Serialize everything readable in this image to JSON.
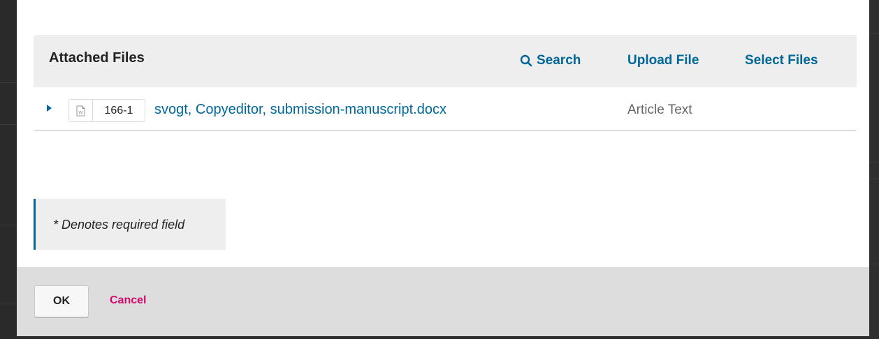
{
  "grid": {
    "title": "Attached Files",
    "actions": {
      "search": "Search",
      "upload": "Upload File",
      "select": "Select Files"
    },
    "rows": [
      {
        "file_id": "166-1",
        "file_name": "svogt, Copyeditor, submission-manuscript.docx",
        "genre": "Article Text",
        "icon": "word-document-icon"
      }
    ]
  },
  "required_note": "* Denotes required field",
  "footer": {
    "ok_label": "OK",
    "cancel_label": "Cancel"
  },
  "colors": {
    "link": "#006798",
    "cancel": "#d00a6c",
    "panel": "#eeeeee",
    "footer": "#dddddd"
  }
}
